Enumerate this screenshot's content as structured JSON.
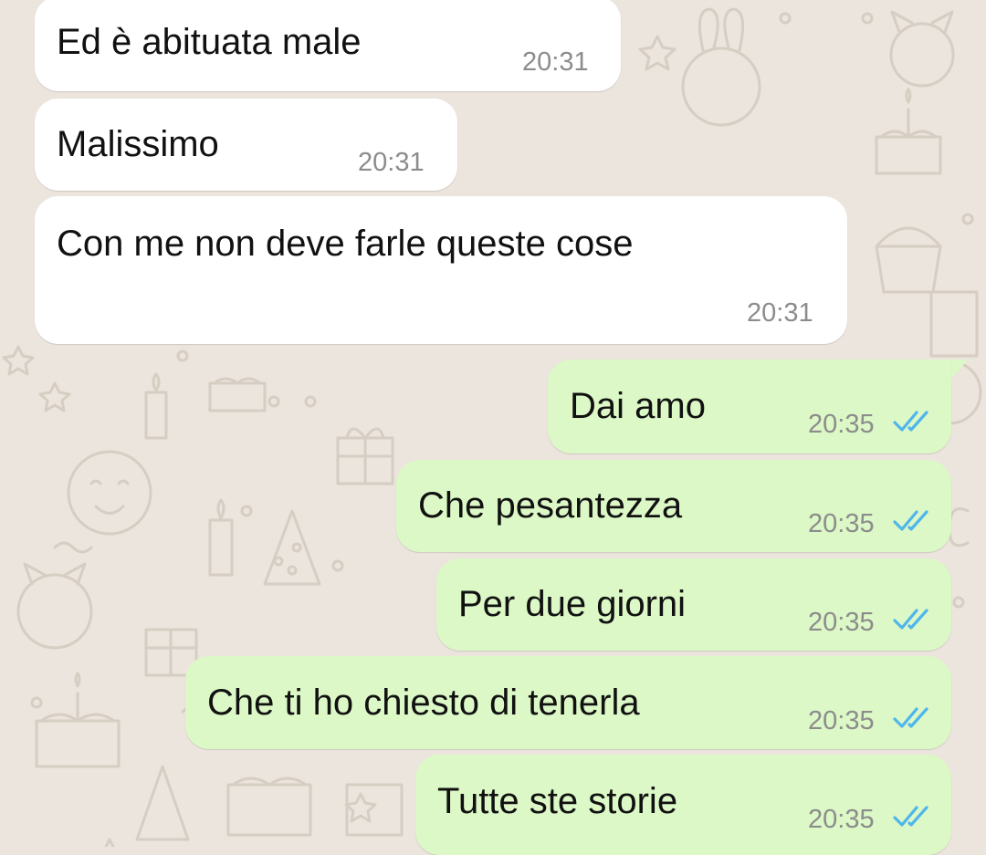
{
  "conversation": {
    "incoming": [
      {
        "text": "Ed è abituata male",
        "time": "20:31"
      },
      {
        "text": "Malissimo",
        "time": "20:31"
      },
      {
        "text": "Con me non deve farle queste cose",
        "time": "20:31"
      }
    ],
    "outgoing": [
      {
        "text": "Dai amo",
        "time": "20:35",
        "status": "read"
      },
      {
        "text": "Che pesantezza",
        "time": "20:35",
        "status": "read"
      },
      {
        "text": "Per due giorni",
        "time": "20:35",
        "status": "read"
      },
      {
        "text": "Che ti ho chiesto di tenerla",
        "time": "20:35",
        "status": "read"
      },
      {
        "text": "Tutte ste storie",
        "time": "20:35",
        "status": "read"
      }
    ]
  },
  "theme": {
    "background": "#ece5dd",
    "incoming_bubble": "#ffffff",
    "outgoing_bubble": "#dcf8c6",
    "read_tick_color": "#4fb6ec",
    "timestamp_color": "#8c8c8c",
    "wallpaper_doodle_color": "#d9d0c7"
  },
  "icons": {
    "read_status": "double-check-icon",
    "wallpaper": "doodle-pattern"
  }
}
